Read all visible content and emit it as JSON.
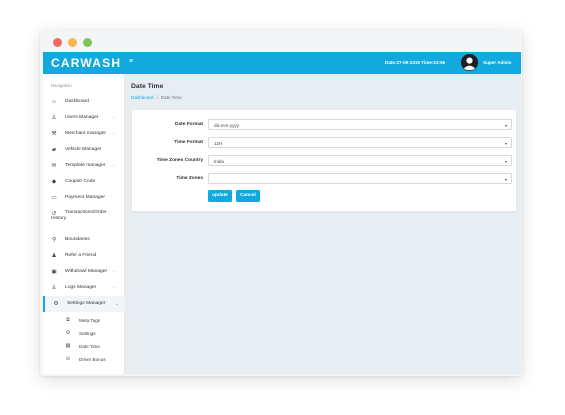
{
  "window": {
    "controls": [
      "close",
      "minimize",
      "maximize"
    ]
  },
  "topbar": {
    "logo": "CARWASH",
    "menu_icon": "≡",
    "datetime": "Date:27-09-2019 Time:03:55",
    "username": "Super Admin",
    "color": "#12a9de"
  },
  "sidebar": {
    "heading": "Navigation",
    "items": [
      {
        "label": "Dashboard",
        "icon": "home-icon",
        "glyph": "⌂",
        "has_children": false
      },
      {
        "label": "Users Manager",
        "icon": "user-icon",
        "glyph": "♙",
        "has_children": true
      },
      {
        "label": "Merchant manager",
        "icon": "merchant-icon",
        "glyph": "⚒",
        "has_children": true
      },
      {
        "label": "Vehicle Manager",
        "icon": "car-icon",
        "glyph": "▰",
        "has_children": false
      },
      {
        "label": "Template manager",
        "icon": "envelope-icon",
        "glyph": "✉",
        "has_children": true
      },
      {
        "label": "Coupon Code",
        "icon": "tag-icon",
        "glyph": "◆",
        "has_children": false
      },
      {
        "label": "Payment Manager",
        "icon": "credit-card-icon",
        "glyph": "▭",
        "has_children": false
      },
      {
        "label_line1": "Transactions/Order",
        "label_line2": "History",
        "icon": "history-icon",
        "glyph": "↺",
        "has_children": false
      },
      {
        "label": "Boundaries",
        "icon": "map-marker-icon",
        "glyph": "⚲",
        "has_children": false
      },
      {
        "label": "Refer a Friend",
        "icon": "user-plus-icon",
        "glyph": "♟",
        "has_children": false
      },
      {
        "label": "Withdrawl Manager",
        "icon": "money-icon",
        "glyph": "▣",
        "has_children": true
      },
      {
        "label": "Logs Manager",
        "icon": "logs-user-icon",
        "glyph": "♙",
        "has_children": true
      },
      {
        "label": "Settings Manager",
        "icon": "gear-icon",
        "glyph": "⚙",
        "has_children": true,
        "expanded": true
      }
    ],
    "chevron_right": "›",
    "chevron_down": "⌄",
    "sub_items": [
      {
        "label": "Meta Tags",
        "icon": "tags-icon",
        "glyph": "⧉"
      },
      {
        "label": "Settings",
        "icon": "cog-icon",
        "glyph": "⚙"
      },
      {
        "label": "Date Time",
        "icon": "calendar-icon",
        "glyph": "▦"
      },
      {
        "label": "Driver Bonus",
        "icon": "bonus-icon",
        "glyph": "⊖"
      }
    ]
  },
  "main": {
    "title": "Date Time",
    "breadcrumb": {
      "home": "Dashboard",
      "separator": "/",
      "current": "Date Time"
    },
    "form": {
      "fields": [
        {
          "label": "Date Format",
          "value": "dd-mm-yyyy"
        },
        {
          "label": "Time Format",
          "value": "12H"
        },
        {
          "label": "Time Zones Country",
          "value": "India"
        },
        {
          "label": "Time Zones",
          "value": ""
        }
      ],
      "dropdown_arrow": "▾",
      "update_label": "update",
      "cancel_label": "Cancel"
    }
  }
}
